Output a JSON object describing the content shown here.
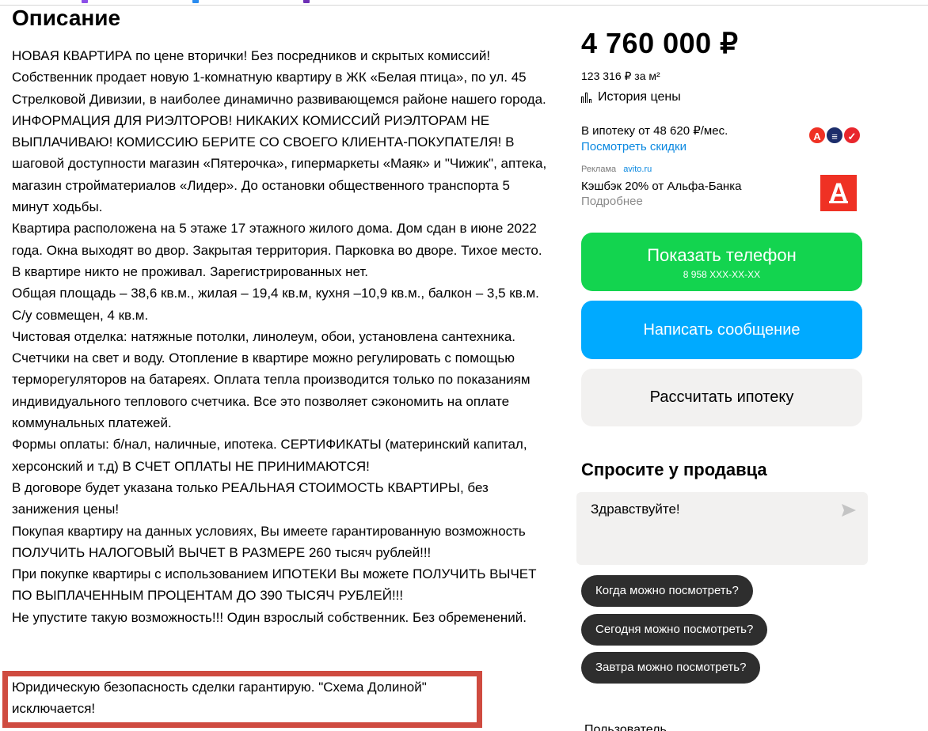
{
  "description": {
    "title": "Описание",
    "paragraphs": [
      "НОВАЯ КВАРТИРА по цене вторички! Без посредников и скрытых комиссий!Собственник продает новую 1-комнатную квартиру в ЖК «Белая птица», по ул. 45 Стрелковой Дивизии, в наиболее динамично развивающемся районе нашего города. ИНФОРМАЦИЯ ДЛЯ РИЭЛТОРОВ! НИКАКИХ КОМИССИЙ РИЭЛТОРАМ НЕ ВЫПЛАЧИВАЮ! КОМИССИЮ БЕРИТЕ СО СВОЕГО КЛИЕНТА-ПОКУПАТЕЛЯ! В шаговой доступности магазин «Пятерочка», гипермаркеты «Маяк» и \"Чижик\", аптека, магазин стройматериалов «Лидер». До остановки общественного транспорта 5 минут ходьбы.",
      "Квартира расположена на 5 этаже 17 этажного жилого дома. Дом сдан в июне 2022 года. Окна выходят во двор. Закрытая территория. Парковка во дворе. Тихое место. В квартире никто не проживал. Зарегистрированных нет.",
      "Общая площадь – 38,6 кв.м., жилая – 19,4 кв.м, кухня –10,9 кв.м., балкон – 3,5 кв.м. С/у совмещен, 4 кв.м.",
      "Чистовая отделка: натяжные потолки, линолеум, обои, установлена сантехника. Счетчики на свет и воду. Отопление в квартире можно регулировать с помощью терморегуляторов на батареях. Оплата тепла производится только по показаниям индивидуального теплового счетчика. Все это позволяет сэкономить на оплате коммунальных платежей.",
      "Формы оплаты: б/нал, наличные, ипотека. СЕРТИФИКАТЫ (материнский капитал, херсонский и т.д) В СЧЕТ ОПЛАТЫ НЕ ПРИНИМАЮТСЯ!",
      "В договоре будет указана только РЕАЛЬНАЯ СТОИМОСТЬ КВАРТИРЫ, без занижения цены!",
      "Покупая квартиру на данных условиях, Вы имеете гарантированную возможность ПОЛУЧИТЬ НАЛОГОВЫЙ ВЫЧЕТ В РАЗМЕРЕ 260 тысяч рублей!!!",
      "При покупке квартиры с использованием ИПОТЕКИ Вы можете ПОЛУЧИТЬ ВЫЧЕТ ПО ВЫПЛАЧЕННЫМ ПРОЦЕНТАМ ДО 390 ТЫСЯЧ РУБЛЕЙ!!!",
      "Не упустите такую возможность!!! Один взрослый собственник. Без обременений."
    ],
    "highlighted": "Юридическую безопасность сделки гарантирую. \"Схема Долиной\" исключается!"
  },
  "sidebar": {
    "price": "4 760 000 ₽",
    "price_per_m2": "123 316 ₽ за м²",
    "price_history": "История цены",
    "mortgage": "В ипотеку от 48 620 ₽/мес.",
    "discounts_link": "Посмотреть скидки",
    "ad_label": "Реклама",
    "ad_source": "avito.ru",
    "cashback": "Кэшбэк 20% от Альфа-Банка",
    "more": "Подробнее",
    "alfa_letter": "А",
    "show_phone": "Показать телефон",
    "phone_masked": "8 958 XXX-XX-XX",
    "write_message": "Написать сообщение",
    "calc_mortgage": "Рассчитать ипотеку",
    "ask_title": "Спросите у продавца",
    "message_value": "Здравствуйте!",
    "quick_questions": [
      "Когда можно посмотреть?",
      "Сегодня можно посмотреть?",
      "Завтра можно посмотреть?"
    ],
    "user_label": "Пользователь"
  },
  "colors": {
    "green_button": "#13d44f",
    "blue_button": "#00aaff",
    "link": "#0a88e0",
    "highlight_border": "#cf4b40",
    "alfa_red": "#ef3124"
  },
  "icons": [
    "chart-bars-icon",
    "send-arrow-icon",
    "alfa-bank-logo",
    "bank-logos"
  ]
}
